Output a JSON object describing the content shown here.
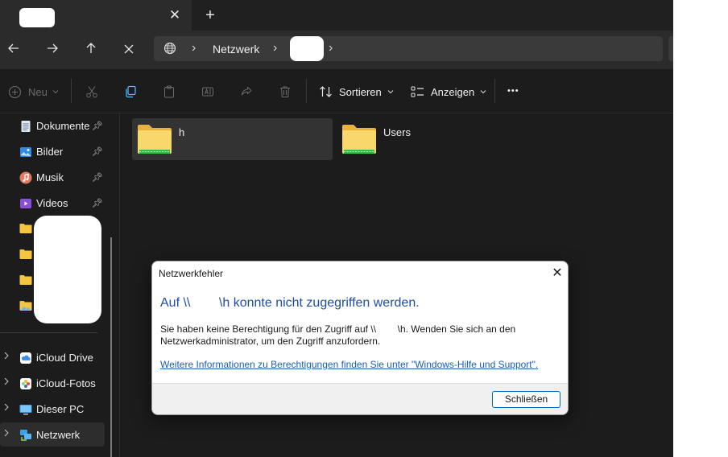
{
  "tabbar": {
    "close_glyph": "✕",
    "new_tab_glyph": "+"
  },
  "nav": {
    "back": "🡐",
    "forward": "🡒",
    "up": "🡑",
    "stop": "✕"
  },
  "address": {
    "crumb": "Netzwerk",
    "sep": "›"
  },
  "toolbar": {
    "new_label": "Neu",
    "sort_label": "Sortieren",
    "view_label": "Anzeigen",
    "more": "•••"
  },
  "sidebar": {
    "quick": [
      {
        "label": "Dokumente",
        "icon": "documents-icon"
      },
      {
        "label": "Bilder",
        "icon": "pictures-icon"
      },
      {
        "label": "Musik",
        "icon": "music-icon"
      },
      {
        "label": "Videos",
        "icon": "videos-icon"
      }
    ],
    "roots": [
      {
        "label": "iCloud Drive",
        "icon": "icloud-drive-icon"
      },
      {
        "label": "iCloud-Fotos",
        "icon": "icloud-photos-icon"
      },
      {
        "label": "Dieser PC",
        "icon": "this-pc-icon"
      },
      {
        "label": "Netzwerk",
        "icon": "network-icon"
      }
    ]
  },
  "content": {
    "folders": [
      {
        "name": "h",
        "icon": "shared-folder-icon"
      },
      {
        "name": "Users",
        "icon": "shared-folder-icon"
      }
    ]
  },
  "dialog": {
    "title": "Netzwerkfehler",
    "heading": "Auf \\\\        \\h konnte nicht zugegriffen werden.",
    "message_1": "Sie haben keine Berechtigung für den Zugriff auf \\\\        \\h. Wenden Sie sich an den",
    "message_2": "Netzwerkadministrator, um den Zugriff anzufordern.",
    "link": "Weitere Informationen zu Berechtigungen finden Sie unter \"Windows-Hilfe und Support\".",
    "button": "Schließen",
    "close_glyph": "✕"
  },
  "colors": {
    "accent": "#0067c0",
    "heading": "#1f4e9c",
    "folder": "#f4c542"
  }
}
